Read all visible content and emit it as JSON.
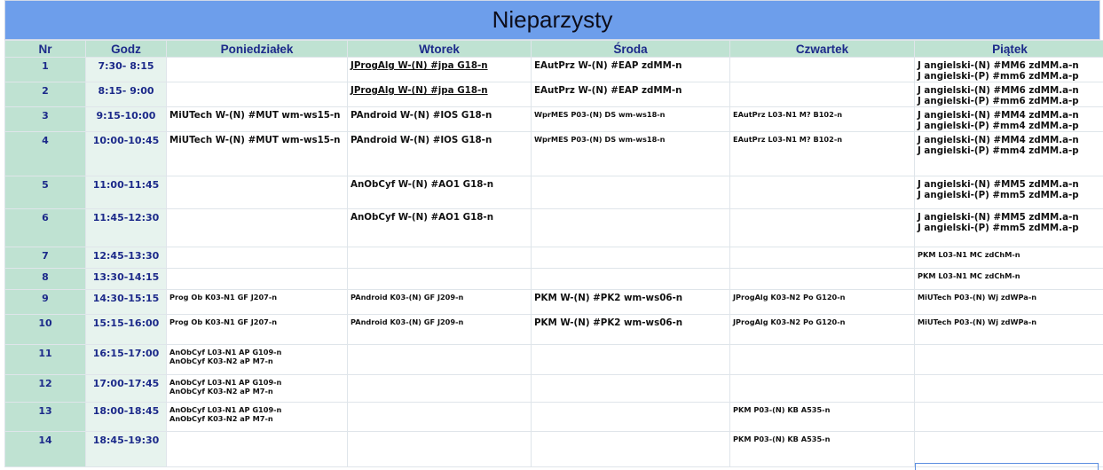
{
  "title": "Nieparzysty",
  "headers": [
    "Nr",
    "Godz",
    "Poniedziałek",
    "Wtorek",
    "Środa",
    "Czwartek",
    "Piątek"
  ],
  "rows": [
    {
      "nr": "1",
      "godz": "7:30- 8:15",
      "mon": [],
      "tue": [
        {
          "t": "JProgAlg W-(N) #jpa G18-n",
          "s": "big",
          "u": true
        }
      ],
      "wed": [
        {
          "t": "EAutPrz W-(N) #EAP zdMM-n",
          "s": "big"
        }
      ],
      "thu": [],
      "fri": [
        {
          "t": "J angielski-(N) #MM6 zdMM.a-n",
          "s": "big"
        },
        {
          "t": "J angielski-(P) #mm6 zdMM.a-p",
          "s": "big"
        }
      ]
    },
    {
      "nr": "2",
      "godz": "8:15- 9:00",
      "mon": [],
      "tue": [
        {
          "t": "JProgAlg W-(N) #jpa G18-n",
          "s": "big",
          "u": true
        }
      ],
      "wed": [
        {
          "t": "EAutPrz W-(N) #EAP zdMM-n",
          "s": "big"
        }
      ],
      "thu": [],
      "fri": [
        {
          "t": "J angielski-(N) #MM6 zdMM.a-n",
          "s": "big"
        },
        {
          "t": "J angielski-(P) #mm6 zdMM.a-p",
          "s": "big"
        }
      ]
    },
    {
      "nr": "3",
      "godz": "9:15-10:00",
      "mon": [
        {
          "t": "MiUTech W-(N) #MUT wm-ws15-n",
          "s": "big"
        }
      ],
      "tue": [
        {
          "t": "PAndroid W-(N) #IOS G18-n",
          "s": "big"
        }
      ],
      "wed": [
        {
          "t": "WprMES P03-(N) DS wm-ws18-n",
          "s": "small"
        }
      ],
      "thu": [
        {
          "t": "EAutPrz L03-N1 M? B102-n",
          "s": "small"
        }
      ],
      "fri": [
        {
          "t": "J angielski-(N) #MM4 zdMM.a-n",
          "s": "big"
        },
        {
          "t": "J angielski-(P) #mm4 zdMM.a-p",
          "s": "big"
        }
      ]
    },
    {
      "nr": "4",
      "godz": "10:00-10:45",
      "mon": [
        {
          "t": "MiUTech W-(N) #MUT wm-ws15-n",
          "s": "big"
        }
      ],
      "tue": [
        {
          "t": "PAndroid W-(N) #IOS G18-n",
          "s": "big"
        }
      ],
      "wed": [
        {
          "t": "WprMES P03-(N) DS wm-ws18-n",
          "s": "small"
        }
      ],
      "thu": [
        {
          "t": "EAutPrz L03-N1 M? B102-n",
          "s": "small"
        }
      ],
      "fri": [
        {
          "t": "J angielski-(N) #MM4 zdMM.a-n",
          "s": "big"
        },
        {
          "t": "J angielski-(P) #mm4 zdMM.a-p",
          "s": "big"
        }
      ]
    },
    {
      "nr": "5",
      "godz": "11:00-11:45",
      "mon": [],
      "tue": [
        {
          "t": "AnObCyf W-(N) #AO1 G18-n",
          "s": "big"
        }
      ],
      "wed": [],
      "thu": [],
      "fri": [
        {
          "t": "J angielski-(N) #MM5 zdMM.a-n",
          "s": "big"
        },
        {
          "t": "J angielski-(P) #mm5 zdMM.a-p",
          "s": "big"
        }
      ]
    },
    {
      "nr": "6",
      "godz": "11:45-12:30",
      "mon": [],
      "tue": [
        {
          "t": "AnObCyf W-(N) #AO1 G18-n",
          "s": "big"
        }
      ],
      "wed": [],
      "thu": [],
      "fri": [
        {
          "t": "J angielski-(N) #MM5 zdMM.a-n",
          "s": "big"
        },
        {
          "t": "J angielski-(P) #mm5 zdMM.a-p",
          "s": "big"
        }
      ]
    },
    {
      "nr": "7",
      "godz": "12:45-13:30",
      "mon": [],
      "tue": [],
      "wed": [],
      "thu": [],
      "fri": [
        {
          "t": "PKM L03-N1 MC zdChM-n",
          "s": "small"
        }
      ]
    },
    {
      "nr": "8",
      "godz": "13:30-14:15",
      "mon": [],
      "tue": [],
      "wed": [],
      "thu": [],
      "fri": [
        {
          "t": "PKM L03-N1 MC zdChM-n",
          "s": "small"
        }
      ]
    },
    {
      "nr": "9",
      "godz": "14:30-15:15",
      "mon": [
        {
          "t": "Prog Ob K03-N1 GF J207-n",
          "s": "small"
        }
      ],
      "tue": [
        {
          "t": "PAndroid K03-(N) GF J209-n",
          "s": "small"
        }
      ],
      "wed": [
        {
          "t": "PKM W-(N) #PK2 wm-ws06-n",
          "s": "big"
        }
      ],
      "thu": [
        {
          "t": "JProgAlg K03-N2 Po G120-n",
          "s": "small"
        }
      ],
      "fri": [
        {
          "t": "MiUTech P03-(N) Wj zdWPa-n",
          "s": "small"
        }
      ]
    },
    {
      "nr": "10",
      "godz": "15:15-16:00",
      "mon": [
        {
          "t": "Prog Ob K03-N1 GF J207-n",
          "s": "small"
        }
      ],
      "tue": [
        {
          "t": "PAndroid K03-(N) GF J209-n",
          "s": "small"
        }
      ],
      "wed": [
        {
          "t": "PKM W-(N) #PK2 wm-ws06-n",
          "s": "big"
        }
      ],
      "thu": [
        {
          "t": "JProgAlg K03-N2 Po G120-n",
          "s": "small"
        }
      ],
      "fri": [
        {
          "t": "MiUTech P03-(N) Wj zdWPa-n",
          "s": "small"
        }
      ]
    },
    {
      "nr": "11",
      "godz": "16:15-17:00",
      "mon": [
        {
          "t": "AnObCyf L03-N1 AP G109-n",
          "s": "small"
        },
        {
          "t": "AnObCyf K03-N2 aP M7-n",
          "s": "small"
        }
      ],
      "tue": [],
      "wed": [],
      "thu": [],
      "fri": []
    },
    {
      "nr": "12",
      "godz": "17:00-17:45",
      "mon": [
        {
          "t": "AnObCyf L03-N1 AP G109-n",
          "s": "small"
        },
        {
          "t": "AnObCyf K03-N2 aP M7-n",
          "s": "small"
        }
      ],
      "tue": [],
      "wed": [],
      "thu": [],
      "fri": []
    },
    {
      "nr": "13",
      "godz": "18:00-18:45",
      "mon": [
        {
          "t": "AnObCyf L03-N1 AP G109-n",
          "s": "small"
        },
        {
          "t": "AnObCyf K03-N2 aP M7-n",
          "s": "small"
        }
      ],
      "tue": [],
      "wed": [],
      "thu": [
        {
          "t": "PKM P03-(N) KB A535-n",
          "s": "small"
        }
      ],
      "fri": []
    },
    {
      "nr": "14",
      "godz": "18:45-19:30",
      "mon": [],
      "tue": [],
      "wed": [],
      "thu": [
        {
          "t": "PKM P03-(N) KB A535-n",
          "s": "small"
        }
      ],
      "fri": []
    }
  ]
}
